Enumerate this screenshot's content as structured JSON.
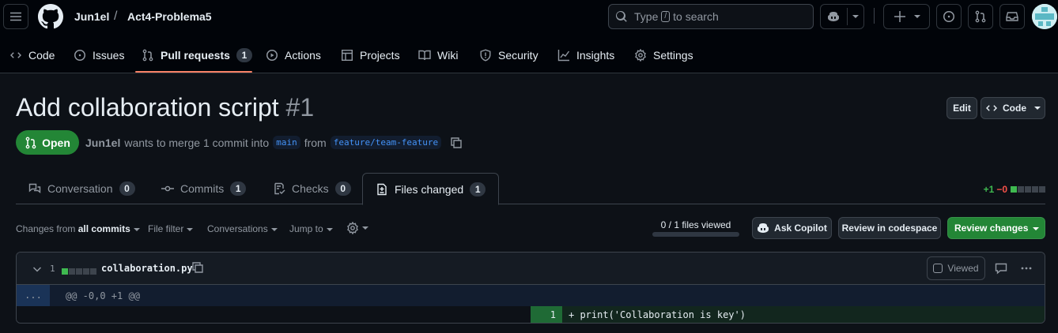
{
  "header": {
    "owner": "Jun1el",
    "separator": "/",
    "repo": "Act4-Problema5",
    "search_prefix": "Type",
    "search_key": "/",
    "search_suffix": "to search"
  },
  "repo_nav": [
    {
      "label": "Code",
      "icon": "code-icon"
    },
    {
      "label": "Issues",
      "icon": "issue-opened-icon"
    },
    {
      "label": "Pull requests",
      "icon": "git-pull-request-icon",
      "count": "1",
      "active": true
    },
    {
      "label": "Actions",
      "icon": "play-icon"
    },
    {
      "label": "Projects",
      "icon": "table-icon"
    },
    {
      "label": "Wiki",
      "icon": "book-icon"
    },
    {
      "label": "Security",
      "icon": "shield-icon"
    },
    {
      "label": "Insights",
      "icon": "graph-icon"
    },
    {
      "label": "Settings",
      "icon": "gear-icon"
    }
  ],
  "pr": {
    "title": "Add collaboration script",
    "number": "#1",
    "edit_label": "Edit",
    "code_label": "Code",
    "state": "Open",
    "author": "Jun1el",
    "meta_text": "wants to merge 1 commit into",
    "base_branch": "main",
    "from_text": "from",
    "head_branch": "feature/team-feature"
  },
  "pr_tabs": [
    {
      "label": "Conversation",
      "count": "0"
    },
    {
      "label": "Commits",
      "count": "1"
    },
    {
      "label": "Checks",
      "count": "0"
    },
    {
      "label": "Files changed",
      "count": "1",
      "active": true
    }
  ],
  "diffstat": {
    "additions": "+1",
    "deletions": "−0"
  },
  "toolbar": {
    "changes_from": "Changes from",
    "changes_value": "all commits",
    "file_filter": "File filter",
    "conversations": "Conversations",
    "jump_to": "Jump to",
    "files_viewed": "0 / 1 files viewed",
    "files_viewed_fraction": 0,
    "ask_copilot": "Ask Copilot",
    "review_codespace": "Review in codespace",
    "review_changes": "Review changes"
  },
  "file": {
    "changes": "1",
    "name": "collaboration.py",
    "viewed_label": "Viewed",
    "hunk_expand": "...",
    "hunk_header": "@@ -0,0 +1 @@",
    "line_number": "1",
    "line_code": "+ print('Collaboration is key')"
  },
  "colors": {
    "accent_green": "#238636",
    "nav_underline": "#f78166",
    "link_blue": "#4493f8"
  }
}
